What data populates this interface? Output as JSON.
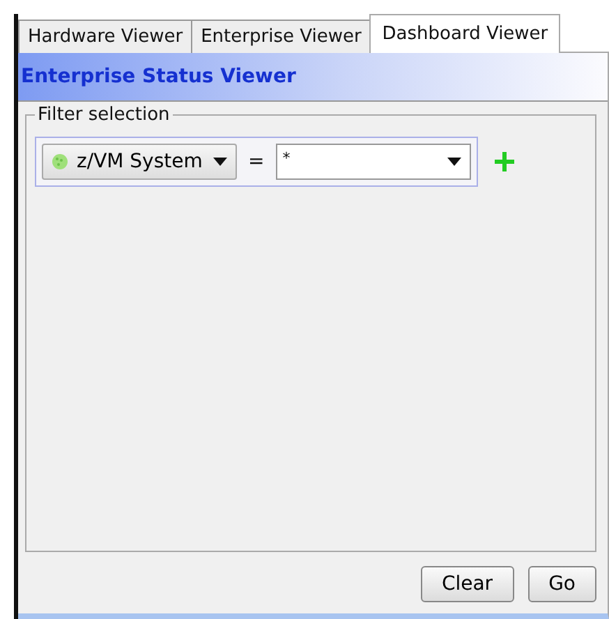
{
  "tabs": [
    {
      "label": "Hardware Viewer",
      "selected": false
    },
    {
      "label": "Enterprise Viewer",
      "selected": false
    },
    {
      "label": "Dashboard Viewer",
      "selected": true
    }
  ],
  "header": {
    "title": "Enterprise Status Viewer"
  },
  "filter": {
    "legend": "Filter selection",
    "field": "z/VM System",
    "operator": "=",
    "value": "*"
  },
  "buttons": [
    "Clear",
    "Go"
  ]
}
